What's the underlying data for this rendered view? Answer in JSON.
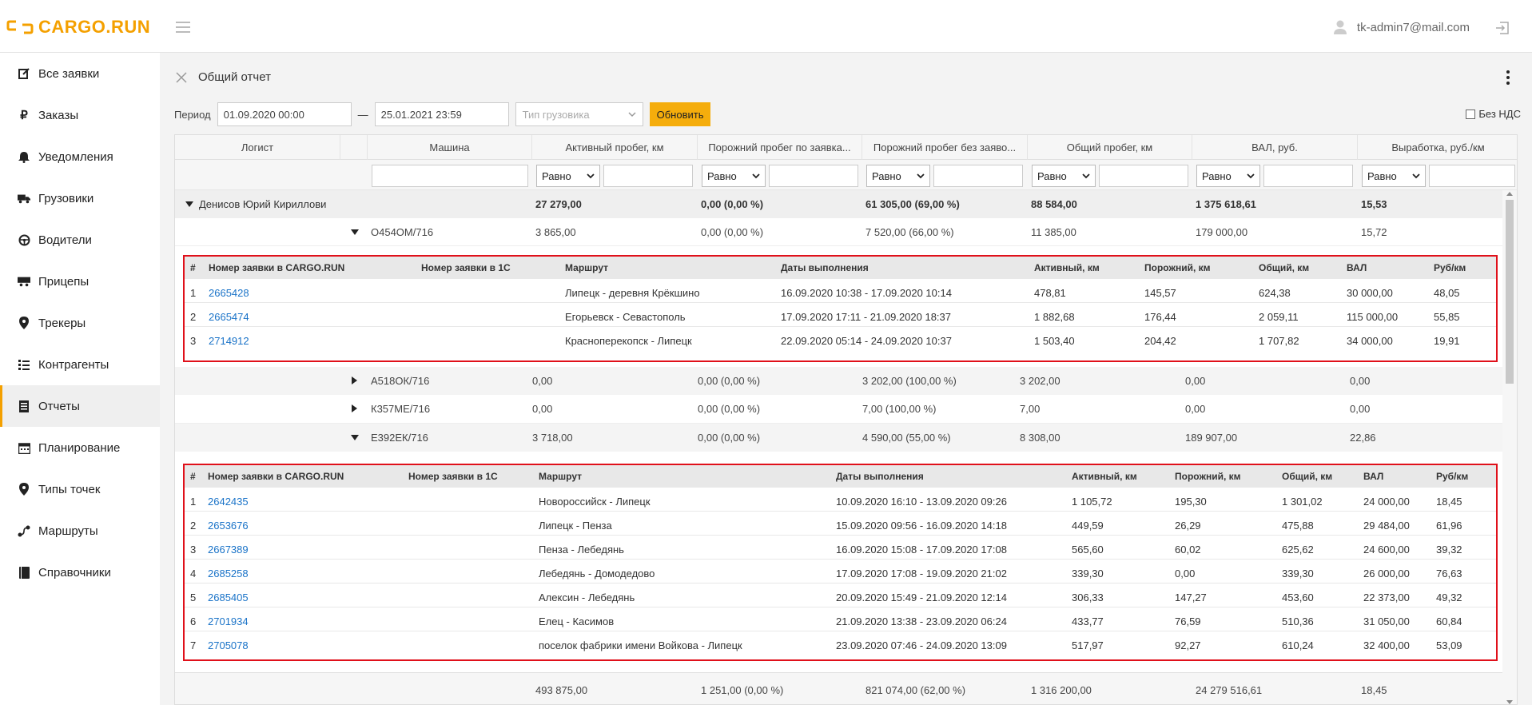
{
  "app": {
    "logo_text": "CARGO.RUN",
    "user_email": "tk-admin7@mail.com",
    "accent": "#f4a000"
  },
  "sidebar": {
    "items": [
      {
        "label": "Все заявки",
        "icon": "edit-icon"
      },
      {
        "label": "Заказы",
        "icon": "ruble-icon"
      },
      {
        "label": "Уведомления",
        "icon": "bell-icon"
      },
      {
        "label": "Грузовики",
        "icon": "truck-icon"
      },
      {
        "label": "Водители",
        "icon": "steering-wheel-icon"
      },
      {
        "label": "Прицепы",
        "icon": "trailer-icon"
      },
      {
        "label": "Трекеры",
        "icon": "map-pin-icon"
      },
      {
        "label": "Контрагенты",
        "icon": "list-icon"
      },
      {
        "label": "Отчеты",
        "icon": "report-icon",
        "active": true
      },
      {
        "label": "Планирование",
        "icon": "calendar-icon"
      },
      {
        "label": "Типы точек",
        "icon": "map-pin-icon"
      },
      {
        "label": "Маршруты",
        "icon": "route-icon"
      },
      {
        "label": "Справочники",
        "icon": "book-icon"
      }
    ]
  },
  "report": {
    "title": "Общий отчет",
    "period_label": "Период",
    "period_from": "01.09.2020 00:00",
    "period_dash": "—",
    "period_to": "25.01.2021 23:59",
    "truck_type_placeholder": "Тип грузовика",
    "refresh_label": "Обновить",
    "no_vat_label": "Без НДС"
  },
  "grid": {
    "columns": [
      "Логист",
      "",
      "Машина",
      "Активный пробег, км",
      "Порожний пробег по заявка...",
      "Порожний пробег без заяво...",
      "Общий пробег, км",
      "ВАЛ, руб.",
      "Выработка, руб./км"
    ],
    "filter_op": "Равно",
    "logist_row": {
      "name": "Денисов Юрий Кириллови",
      "active": "27 279,00",
      "empty_req": "0,00 (0,00 %)",
      "empty_noreq": "61 305,00 (69,00 %)",
      "total": "88 584,00",
      "val": "1 375 618,61",
      "output": "15,53"
    },
    "trucks": [
      {
        "plate": "О454ОМ/716",
        "active": "3 865,00",
        "empty_req": "0,00 (0,00 %)",
        "empty_noreq": "7 520,00 (66,00 %)",
        "total": "11 385,00",
        "val": "179 000,00",
        "output": "15,72"
      },
      {
        "plate": "А518ОК/716",
        "active": "0,00",
        "empty_req": "0,00 (0,00 %)",
        "empty_noreq": "3 202,00 (100,00 %)",
        "total": "3 202,00",
        "val": "0,00",
        "output": "0,00"
      },
      {
        "plate": "К357МЕ/716",
        "active": "0,00",
        "empty_req": "0,00 (0,00 %)",
        "empty_noreq": "7,00 (100,00 %)",
        "total": "7,00",
        "val": "0,00",
        "output": "0,00"
      },
      {
        "plate": "Е392ЕК/716",
        "active": "3 718,00",
        "empty_req": "0,00 (0,00 %)",
        "empty_noreq": "4 590,00 (55,00 %)",
        "total": "8 308,00",
        "val": "189 907,00",
        "output": "22,86"
      }
    ],
    "sub_columns": [
      "#",
      "Номер заявки в CARGO.RUN",
      "Номер заявки в 1С",
      "Маршрут",
      "Даты выполнения",
      "Активный, км",
      "Порожний, км",
      "Общий, км",
      "ВАЛ",
      "Руб/км"
    ],
    "sub1": [
      {
        "n": "1",
        "id": "2665428",
        "route": "Липецк - деревня Крёкшино",
        "dates": "16.09.2020 10:38 - 17.09.2020 10:14",
        "active": "478,81",
        "empty": "145,57",
        "total": "624,38",
        "val": "30 000,00",
        "rkm": "48,05"
      },
      {
        "n": "2",
        "id": "2665474",
        "route": "Егорьевск - Севастополь",
        "dates": "17.09.2020 17:11 - 21.09.2020 18:37",
        "active": "1 882,68",
        "empty": "176,44",
        "total": "2 059,11",
        "val": "115 000,00",
        "rkm": "55,85"
      },
      {
        "n": "3",
        "id": "2714912",
        "route": "Красноперекопск - Липецк",
        "dates": "22.09.2020 05:14 - 24.09.2020 10:37",
        "active": "1 503,40",
        "empty": "204,42",
        "total": "1 707,82",
        "val": "34 000,00",
        "rkm": "19,91"
      }
    ],
    "sub2": [
      {
        "n": "1",
        "id": "2642435",
        "route": "Новороссийск - Липецк",
        "dates": "10.09.2020 16:10 - 13.09.2020 09:26",
        "active": "1 105,72",
        "empty": "195,30",
        "total": "1 301,02",
        "val": "24 000,00",
        "rkm": "18,45"
      },
      {
        "n": "2",
        "id": "2653676",
        "route": "Липецк - Пенза",
        "dates": "15.09.2020 09:56 - 16.09.2020 14:18",
        "active": "449,59",
        "empty": "26,29",
        "total": "475,88",
        "val": "29 484,00",
        "rkm": "61,96"
      },
      {
        "n": "3",
        "id": "2667389",
        "route": "Пенза - Лебедянь",
        "dates": "16.09.2020 15:08 - 17.09.2020 17:08",
        "active": "565,60",
        "empty": "60,02",
        "total": "625,62",
        "val": "24 600,00",
        "rkm": "39,32"
      },
      {
        "n": "4",
        "id": "2685258",
        "route": "Лебедянь - Домодедово",
        "dates": "17.09.2020 17:08 - 19.09.2020 21:02",
        "active": "339,30",
        "empty": "0,00",
        "total": "339,30",
        "val": "26 000,00",
        "rkm": "76,63"
      },
      {
        "n": "5",
        "id": "2685405",
        "route": "Алексин - Лебедянь",
        "dates": "20.09.2020 15:49 - 21.09.2020 12:14",
        "active": "306,33",
        "empty": "147,27",
        "total": "453,60",
        "val": "22 373,00",
        "rkm": "49,32"
      },
      {
        "n": "6",
        "id": "2701934",
        "route": "Елец - Касимов",
        "dates": "21.09.2020 13:38 - 23.09.2020 06:24",
        "active": "433,77",
        "empty": "76,59",
        "total": "510,36",
        "val": "31 050,00",
        "rkm": "60,84"
      },
      {
        "n": "7",
        "id": "2705078",
        "route": "поселок фабрики имени Войкова - Липецк",
        "dates": "23.09.2020 07:46 - 24.09.2020 13:09",
        "active": "517,97",
        "empty": "92,27",
        "total": "610,24",
        "val": "32 400,00",
        "rkm": "53,09"
      }
    ],
    "totals": {
      "active": "493 875,00",
      "empty_req": "1 251,00 (0,00 %)",
      "empty_noreq": "821 074,00 (62,00 %)",
      "total": "1 316 200,00",
      "val": "24 279 516,61",
      "output": "18,45"
    }
  }
}
